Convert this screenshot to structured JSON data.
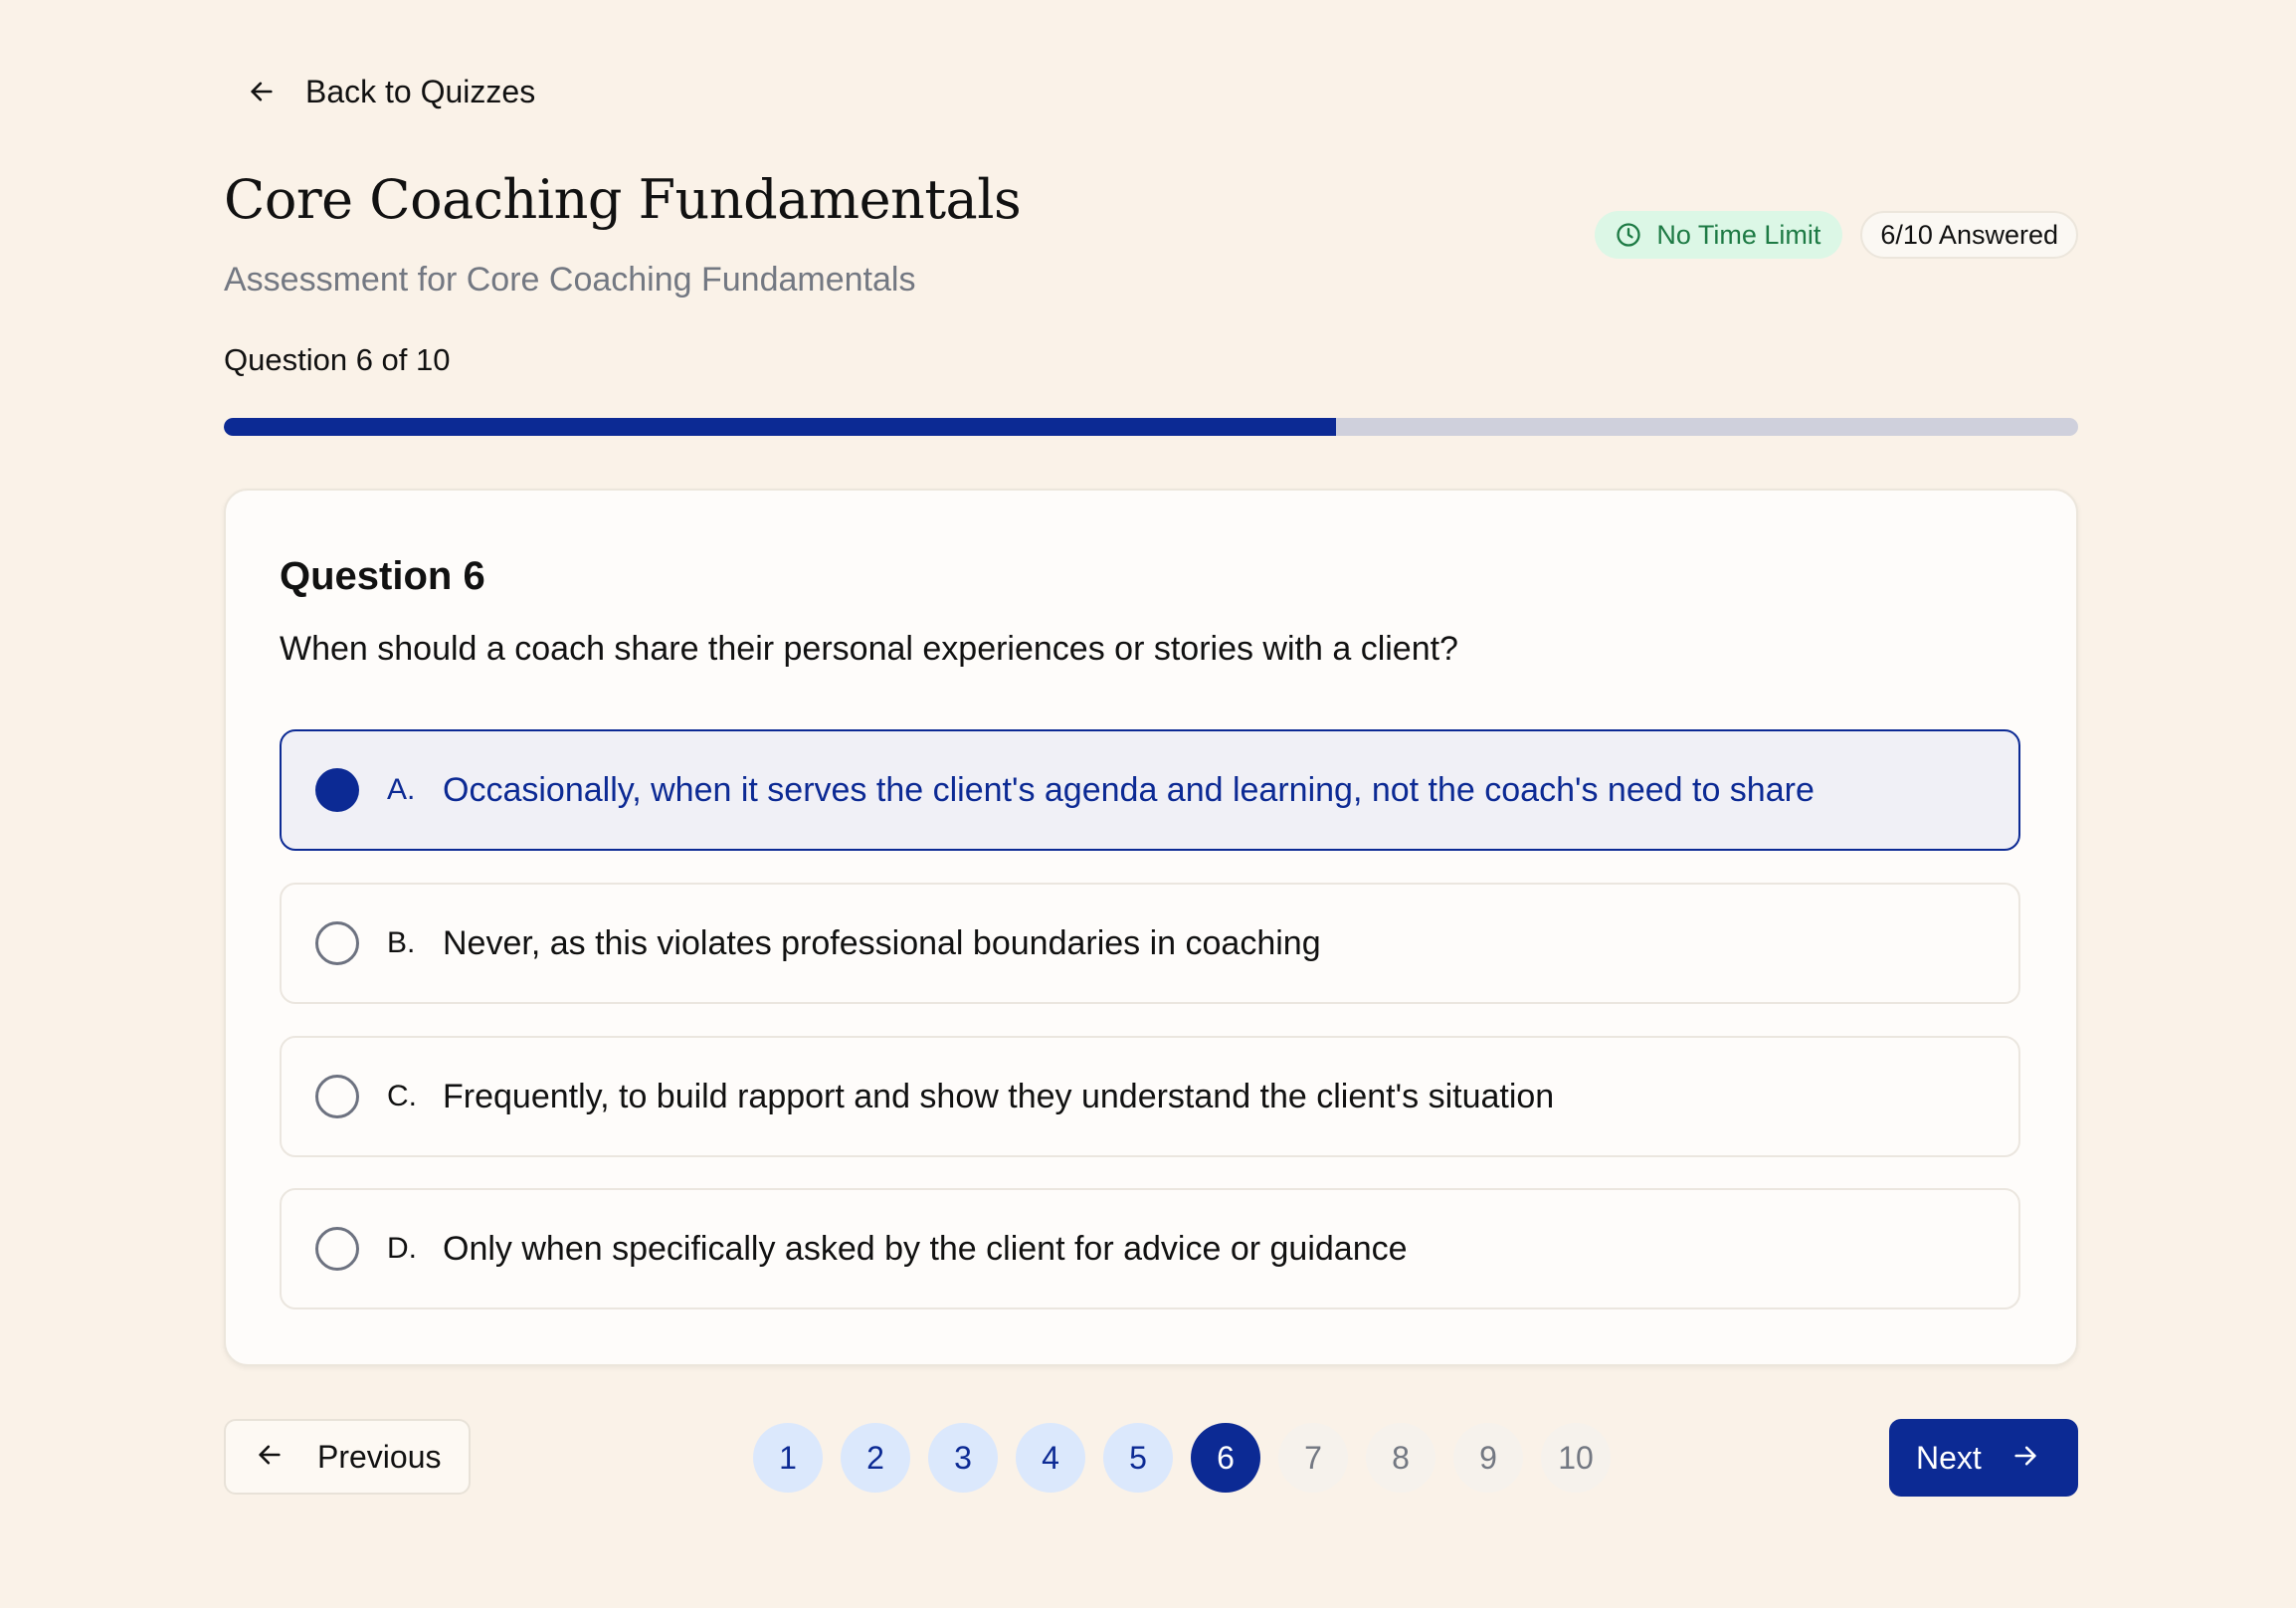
{
  "nav": {
    "back_label": "Back to Quizzes"
  },
  "quiz": {
    "title": "Core Coaching Fundamentals",
    "subtitle": "Assessment for Core Coaching Fundamentals",
    "time_badge": "No Time Limit",
    "answered_badge": "6/10 Answered",
    "question_counter": "Question 6 of 10",
    "progress_fraction": 0.6
  },
  "question": {
    "heading": "Question 6",
    "text": "When should a coach share their personal experiences or stories with a client?",
    "options": [
      {
        "letter": "A.",
        "text": "Occasionally, when it serves the client's agenda and learning, not the coach's need to share",
        "selected": true
      },
      {
        "letter": "B.",
        "text": "Never, as this violates professional boundaries in coaching",
        "selected": false
      },
      {
        "letter": "C.",
        "text": "Frequently, to build rapport and show they understand the client's situation",
        "selected": false
      },
      {
        "letter": "D.",
        "text": "Only when specifically asked by the client for advice or guidance",
        "selected": false
      }
    ]
  },
  "footer": {
    "previous_label": "Previous",
    "next_label": "Next",
    "pages": [
      {
        "label": "1",
        "state": "answered"
      },
      {
        "label": "2",
        "state": "answered"
      },
      {
        "label": "3",
        "state": "answered"
      },
      {
        "label": "4",
        "state": "answered"
      },
      {
        "label": "5",
        "state": "answered"
      },
      {
        "label": "6",
        "state": "current"
      },
      {
        "label": "7",
        "state": "pending"
      },
      {
        "label": "8",
        "state": "pending"
      },
      {
        "label": "9",
        "state": "pending"
      },
      {
        "label": "10",
        "state": "pending"
      }
    ]
  },
  "colors": {
    "background": "#faf2e8",
    "accent": "#0c2a94",
    "progress_track": "#cfd0dc",
    "time_badge_bg": "#dcf7e6",
    "time_badge_text": "#1d7a44",
    "answered_page_bg": "#dbe8fc"
  },
  "icons": {
    "back": "arrow-left-icon",
    "time": "clock-icon",
    "previous": "arrow-left-icon",
    "next": "arrow-right-icon"
  }
}
